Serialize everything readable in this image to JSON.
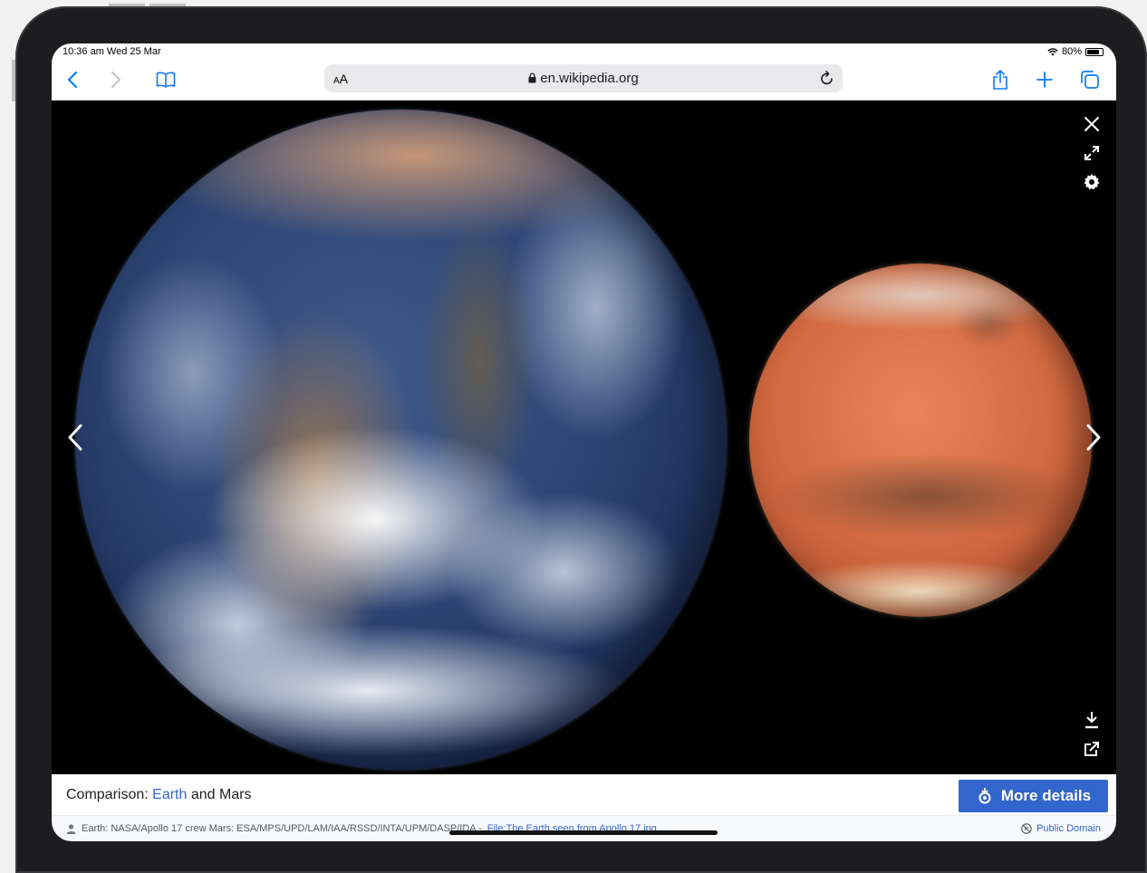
{
  "status_bar": {
    "time_date": "10:36 am  Wed 25 Mar",
    "battery": "80%",
    "battery_level": 0.8
  },
  "toolbar": {
    "text_size_label": "AA",
    "url": "en.wikipedia.org",
    "icons": [
      "back-chevron",
      "forward-chevron",
      "bookmarks-book",
      "share",
      "new-tab-plus",
      "tabs-overview"
    ]
  },
  "viewer": {
    "caption_prefix": "Comparison: ",
    "caption_link": "Earth",
    "caption_suffix": " and Mars",
    "more_details_label": "More details",
    "author_text": "Earth: NASA/Apollo 17 crew Mars: ESA/MPS/UPD/LAM/IAA/RSSD/INTA/UPM/DASP/IDA -",
    "file_link": "File:The Earth seen from Apollo 17.jpg",
    "license": "Public Domain",
    "icons": [
      "close",
      "fullscreen",
      "settings",
      "previous",
      "next",
      "download",
      "share"
    ]
  },
  "colors": {
    "link": "#3366cc",
    "button": "#3366cc",
    "ios_blue": "#0a7aff"
  }
}
